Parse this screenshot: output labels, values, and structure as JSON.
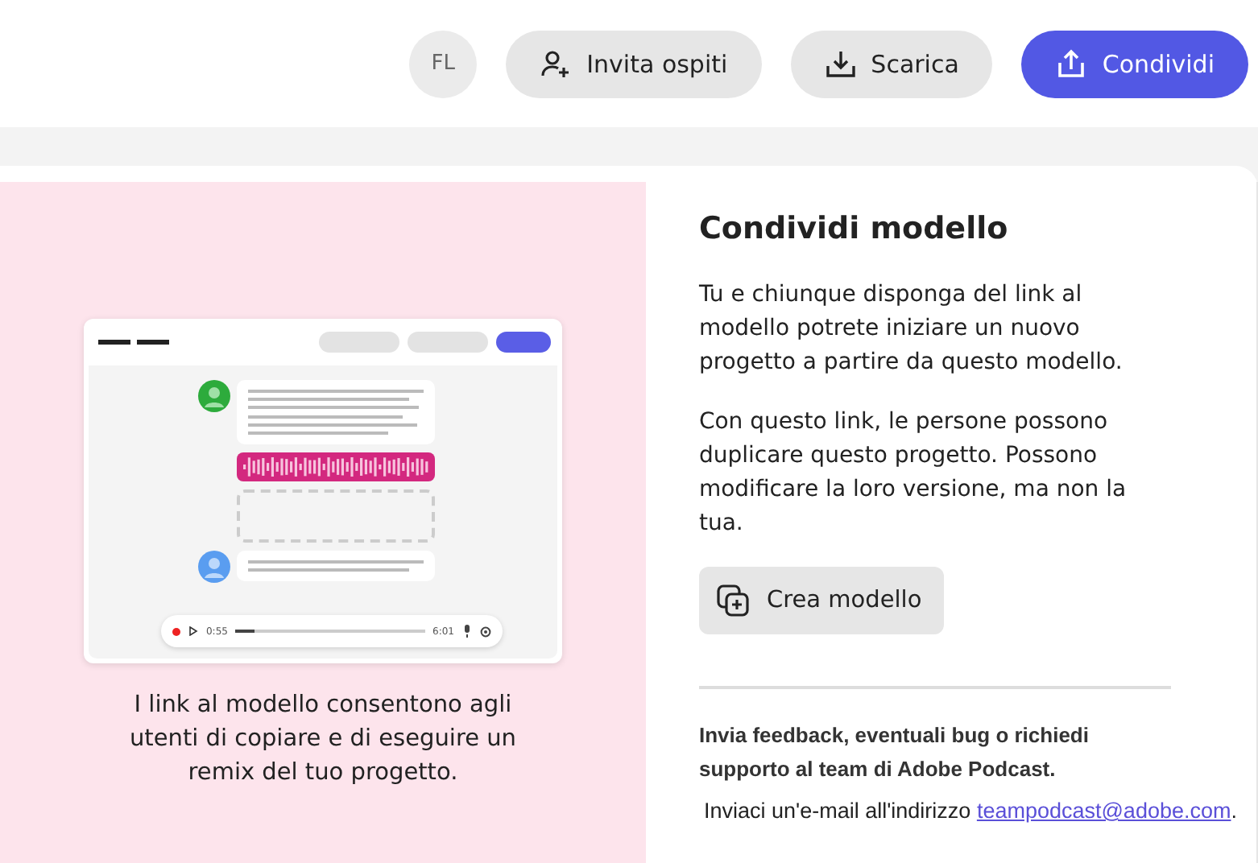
{
  "header": {
    "avatar_initials": "FL",
    "buttons": [
      {
        "label": "Invita ospiti",
        "kind": "invite",
        "primary": false
      },
      {
        "label": "Scarica",
        "kind": "download",
        "primary": false
      },
      {
        "label": "Condividi",
        "kind": "share",
        "primary": true
      }
    ]
  },
  "preview": {
    "player": {
      "elapsed": "0:55",
      "total": "6:01",
      "level": 0.1
    },
    "caption": "I link al modello consentono agli utenti di copiare e di eseguire un remix del tuo progetto."
  },
  "share_panel": {
    "title": "Condividi modello",
    "paragraphs": [
      "Tu e chiunque disponga del link al modello potrete iniziare un nuovo progetto a partire da questo modello.",
      "Con questo link, le persone possono duplicare questo progetto. Possono modificare la loro versione, ma non la tua."
    ],
    "button": "Crea modello"
  },
  "feedback": {
    "heading": "Invia feedback, eventuali bug o richiedi supporto al team di Adobe Podcast.",
    "email_prefix": "Inviaci un'e-mail all'indirizzo ",
    "email_link": "teampodcast@adobe.com",
    "email_suffix": "."
  }
}
